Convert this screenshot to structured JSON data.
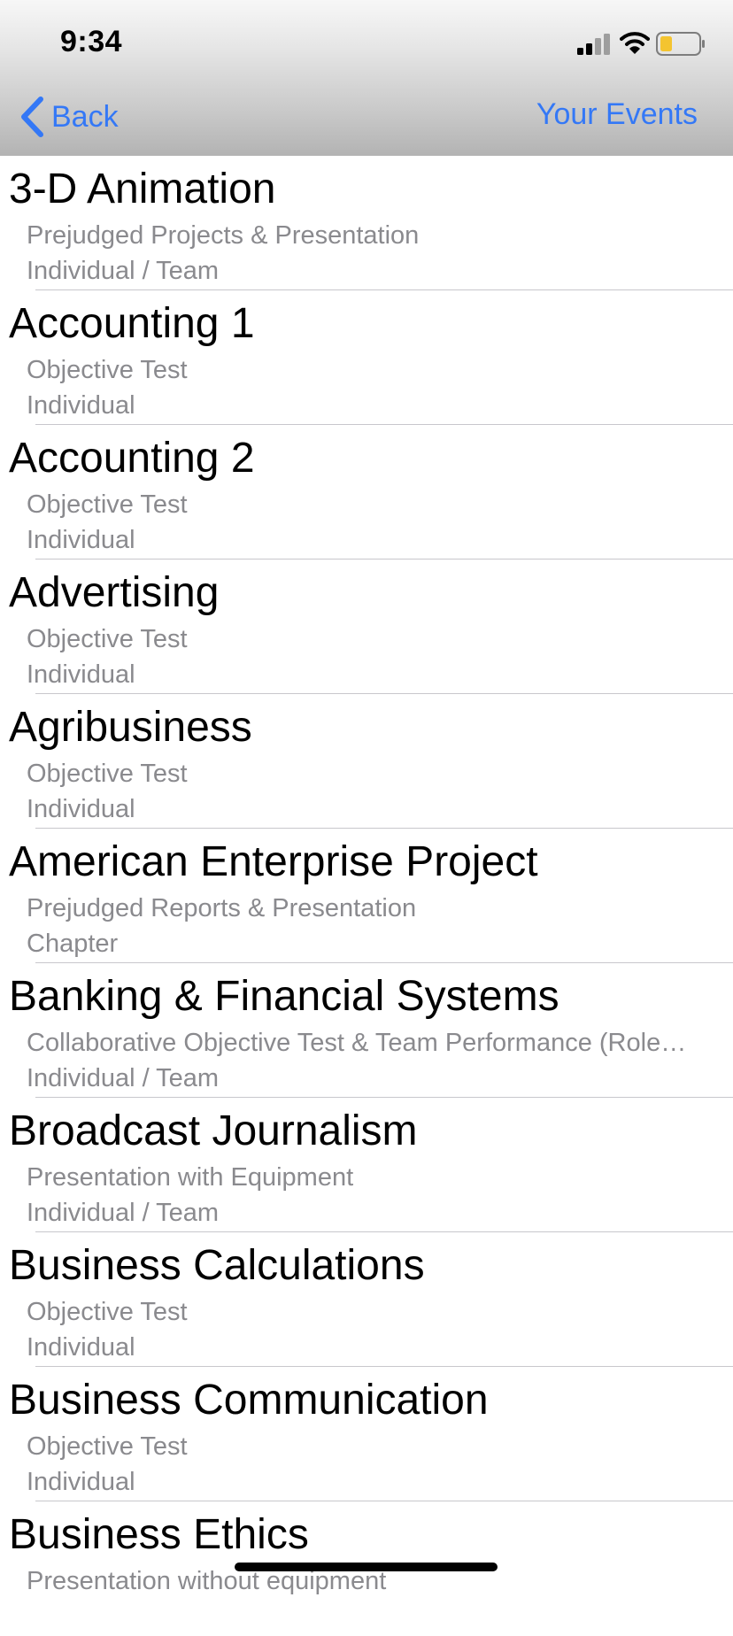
{
  "status_bar": {
    "time": "9:34",
    "signal_icon": "cellular-signal-icon",
    "wifi_icon": "wifi-icon",
    "battery_icon": "battery-low-icon",
    "battery_color": "#f4c430"
  },
  "nav": {
    "back_label": "Back",
    "back_icon": "chevron-left-icon",
    "right_label": "Your Events",
    "accent_color": "#3478f6"
  },
  "events": [
    {
      "title": "3-D Animation",
      "type": "Prejudged Projects & Presentation",
      "team": "Individual / Team"
    },
    {
      "title": "Accounting 1",
      "type": "Objective Test",
      "team": "Individual"
    },
    {
      "title": "Accounting 2",
      "type": "Objective Test",
      "team": "Individual"
    },
    {
      "title": "Advertising",
      "type": "Objective Test",
      "team": "Individual"
    },
    {
      "title": "Agribusiness",
      "type": "Objective Test",
      "team": "Individual"
    },
    {
      "title": "American Enterprise Project",
      "type": "Prejudged Reports & Presentation",
      "team": "Chapter"
    },
    {
      "title": "Banking & Financial Systems",
      "type": "Collaborative Objective Test & Team Performance (Role…",
      "team": "Individual / Team"
    },
    {
      "title": "Broadcast Journalism",
      "type": "Presentation with Equipment",
      "team": "Individual / Team"
    },
    {
      "title": "Business Calculations",
      "type": "Objective Test",
      "team": "Individual"
    },
    {
      "title": "Business Communication",
      "type": "Objective Test",
      "team": "Individual"
    },
    {
      "title": "Business Ethics",
      "type": "Presentation without equipment",
      "team": ""
    }
  ]
}
